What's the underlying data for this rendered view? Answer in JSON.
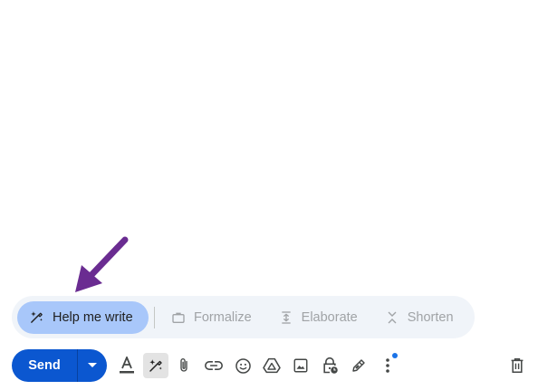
{
  "ai_bar": {
    "help_me_write": "Help me write",
    "formalize": "Formalize",
    "elaborate": "Elaborate",
    "shorten": "Shorten"
  },
  "toolbar": {
    "send_label": "Send",
    "tools": [
      "formatting-options-icon",
      "help-me-write-icon",
      "attach-files-icon",
      "insert-link-icon",
      "insert-emoji-icon",
      "google-drive-icon",
      "insert-photo-icon",
      "confidential-mode-icon",
      "insert-signature-icon",
      "more-options-icon",
      "discard-draft-icon"
    ]
  },
  "colors": {
    "send_blue": "#0b57d0",
    "help_chip": "#a8c7fa",
    "ai_bar_bg": "#f0f4f9",
    "arrow": "#6a2c91",
    "notification_dot": "#1a73e8"
  }
}
